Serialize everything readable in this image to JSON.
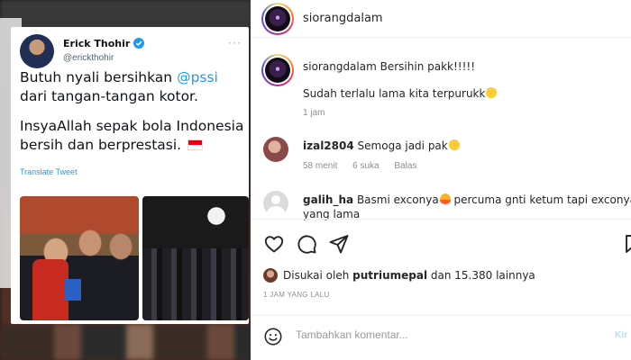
{
  "tweet": {
    "name": "Erick Thohir",
    "handle": "@erickthohir",
    "text_before_mention": "Butuh nyali bersihkan ",
    "mention": "@pssi",
    "text_after_mention": " dari tangan-tangan kotor.",
    "text_line2": "InsyaAllah sepak bola Indonesia bersih dan berprestasi.",
    "translate_label": "Translate Tweet"
  },
  "instagram": {
    "header_username": "siorangdalam",
    "caption": {
      "username": "siorangdalam",
      "text": "Bersihin pakk!!!!!",
      "text2": "Sudah terlalu lama kita terpurukk",
      "time": "1 jam"
    },
    "comments": [
      {
        "username": "izal2804",
        "text": "Semoga jadi pak",
        "time": "58 menit",
        "likes": "6 suka",
        "reply": "Balas"
      },
      {
        "username": "galih_ha",
        "text": "Basmi exconya",
        "text_cont": "percuma gnti ketum tapi exconya",
        "text_line2": "yang lama"
      }
    ],
    "likes": {
      "prefix": "Disukai oleh",
      "user": "putriumepal",
      "suffix": "dan 15.380 lainnya"
    },
    "time_ago": "1 JAM YANG LALU",
    "add_comment_placeholder": "Tambahkan komentar...",
    "post_label": "Kir"
  },
  "icons": {
    "like": "heart-icon",
    "comment": "comment-icon",
    "share": "send-icon",
    "save": "bookmark-icon",
    "emoji": "smile-icon",
    "verified": "verified-badge-icon",
    "more": "more-icon"
  },
  "colors": {
    "twitter_blue": "#1d9bf0",
    "instagram_text": "#262626",
    "instagram_meta": "#8e8e8e"
  }
}
